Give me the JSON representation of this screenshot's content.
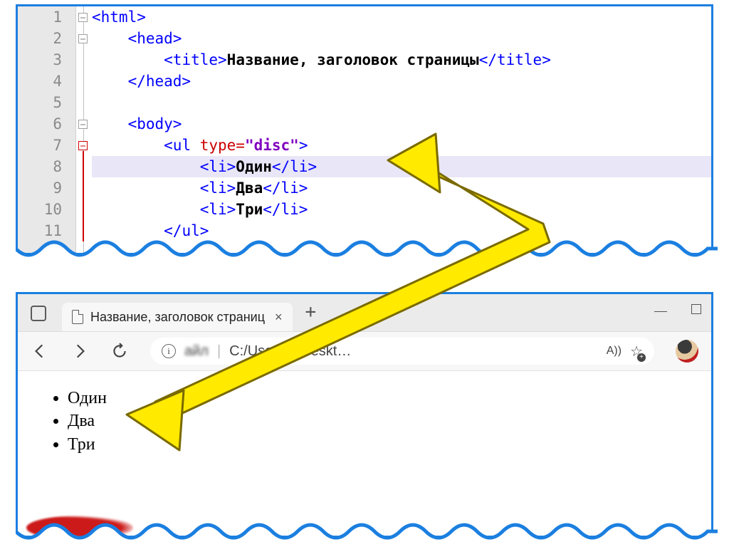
{
  "editor": {
    "line_numbers": [
      "1",
      "2",
      "3",
      "4",
      "5",
      "6",
      "7",
      "8",
      "9",
      "10",
      "11"
    ],
    "code": {
      "l1_open": "<html>",
      "l2_open": "<head>",
      "l3_open": "<title>",
      "l3_text": "Название, заголовок страницы",
      "l3_close": "</title>",
      "l4_close": "</head>",
      "l6_open": "<body>",
      "l7_open": "<ul ",
      "l7_attr": "type=",
      "l7_val": "\"disc\"",
      "l7_close": ">",
      "l8_open": "<li>",
      "l8_text": "Один",
      "l8_close": "</li>",
      "l9_open": "<li>",
      "l9_text": "Два",
      "l9_close": "</li>",
      "l10_open": "<li>",
      "l10_text": "Три",
      "l10_close": "</li>",
      "l11_close": "</ul>"
    },
    "highlighted_line": 8
  },
  "browser": {
    "tab_title": "Название, заголовок страниц",
    "address": {
      "scheme_hidden": "айл",
      "path": "C:/Users/a       Deskt…"
    },
    "readaloud_icon": "A))",
    "list_items": [
      "Один",
      "Два",
      "Три"
    ]
  },
  "colors": {
    "frame": "#1b7fe0",
    "arrow_fill": "#ffea00",
    "arrow_stroke": "#7a6a00",
    "tag": "#0000ff",
    "attr": "#cc0000",
    "val": "#8000c0"
  }
}
